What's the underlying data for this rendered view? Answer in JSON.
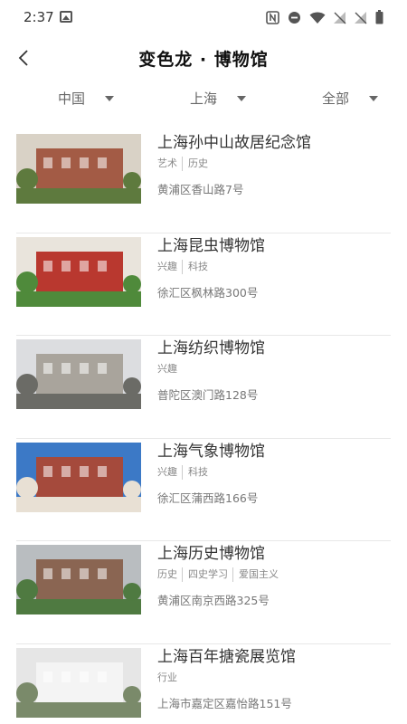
{
  "status_bar": {
    "time": "2:37",
    "icons": [
      "photo-icon",
      "nfc-icon",
      "dnd-icon",
      "wifi-icon",
      "signal-off-icon",
      "signal-off-icon",
      "battery-icon"
    ]
  },
  "header": {
    "back_icon": "chevron-left-icon",
    "title": "变色龙 · 博物馆"
  },
  "filters": [
    {
      "label": "中国",
      "icon": "dropdown-arrow-icon"
    },
    {
      "label": "上海",
      "icon": "dropdown-arrow-icon"
    },
    {
      "label": "全部",
      "icon": "dropdown-arrow-icon"
    }
  ],
  "museums": [
    {
      "name": "上海孙中山故居纪念馆",
      "tags": [
        "艺术",
        "历史"
      ],
      "address": "黄浦区香山路7号",
      "thumb_colors": {
        "sky": "#d9d2c6",
        "main": "#a35b45",
        "ground": "#5e7a3e"
      }
    },
    {
      "name": "上海昆虫博物馆",
      "tags": [
        "兴趣",
        "科技"
      ],
      "address": "徐汇区枫林路300号",
      "thumb_colors": {
        "sky": "#e9e4dc",
        "main": "#b9382f",
        "ground": "#4f8a3b"
      }
    },
    {
      "name": "上海纺织博物馆",
      "tags": [
        "兴趣"
      ],
      "address": "普陀区澳门路128号",
      "thumb_colors": {
        "sky": "#dcdde0",
        "main": "#a9a49c",
        "ground": "#6b6b66"
      }
    },
    {
      "name": "上海气象博物馆",
      "tags": [
        "兴趣",
        "科技"
      ],
      "address": "徐汇区蒲西路166号",
      "thumb_colors": {
        "sky": "#3c79c6",
        "main": "#a54a3c",
        "ground": "#e8e0d4"
      }
    },
    {
      "name": "上海历史博物馆",
      "tags": [
        "历史",
        "四史学习",
        "爱国主义"
      ],
      "address": "黄浦区南京西路325号",
      "thumb_colors": {
        "sky": "#b9bdc0",
        "main": "#8a6552",
        "ground": "#4f7a41"
      }
    },
    {
      "name": "上海百年搪瓷展览馆",
      "tags": [
        "行业"
      ],
      "address": "上海市嘉定区嘉怡路151号",
      "thumb_colors": {
        "sky": "#e6e6e6",
        "main": "#f4f4f4",
        "ground": "#7a8a6a"
      }
    }
  ]
}
